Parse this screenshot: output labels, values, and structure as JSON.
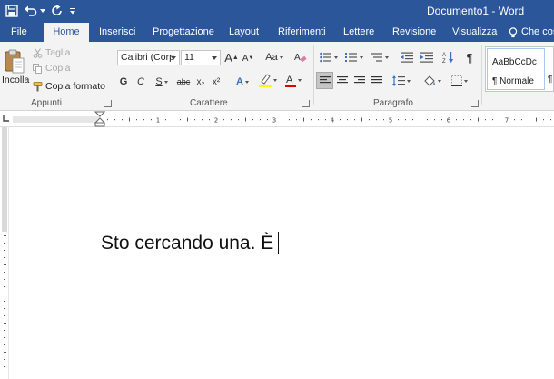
{
  "window": {
    "title": "Documento1 - Word"
  },
  "tabs": {
    "file": "File",
    "home": "Home",
    "insert": "Inserisci",
    "design": "Progettazione",
    "layout": "Layout",
    "references": "Riferimenti",
    "mailings": "Lettere",
    "review": "Revisione",
    "view": "Visualizza",
    "tell_me": "Che cos"
  },
  "clipboard": {
    "group_label": "Appunti",
    "paste": "Incolla",
    "cut": "Taglia",
    "copy": "Copia",
    "format_painter": "Copia formato"
  },
  "font": {
    "group_label": "Carattere",
    "font_name": "Calibri (Corp",
    "font_size": "11",
    "bold": "G",
    "italic": "C",
    "underline": "S",
    "strikethrough": "abc",
    "subscript": "x₂",
    "superscript": "x²",
    "grow": "A",
    "shrink": "A",
    "change_case": "Aa",
    "text_effects": "A",
    "font_color": "A",
    "highlight_color": "#ffff00",
    "font_color_value": "#e00000"
  },
  "paragraph": {
    "group_label": "Paragrafo"
  },
  "styles": {
    "preview": "AaBbCcDc",
    "normal": "¶ Normale",
    "next": "¶ N"
  },
  "document": {
    "text": "Sto cercando una. È"
  },
  "colors": {
    "accent": "#2b579a",
    "ribbon": "#f3f3f3"
  }
}
